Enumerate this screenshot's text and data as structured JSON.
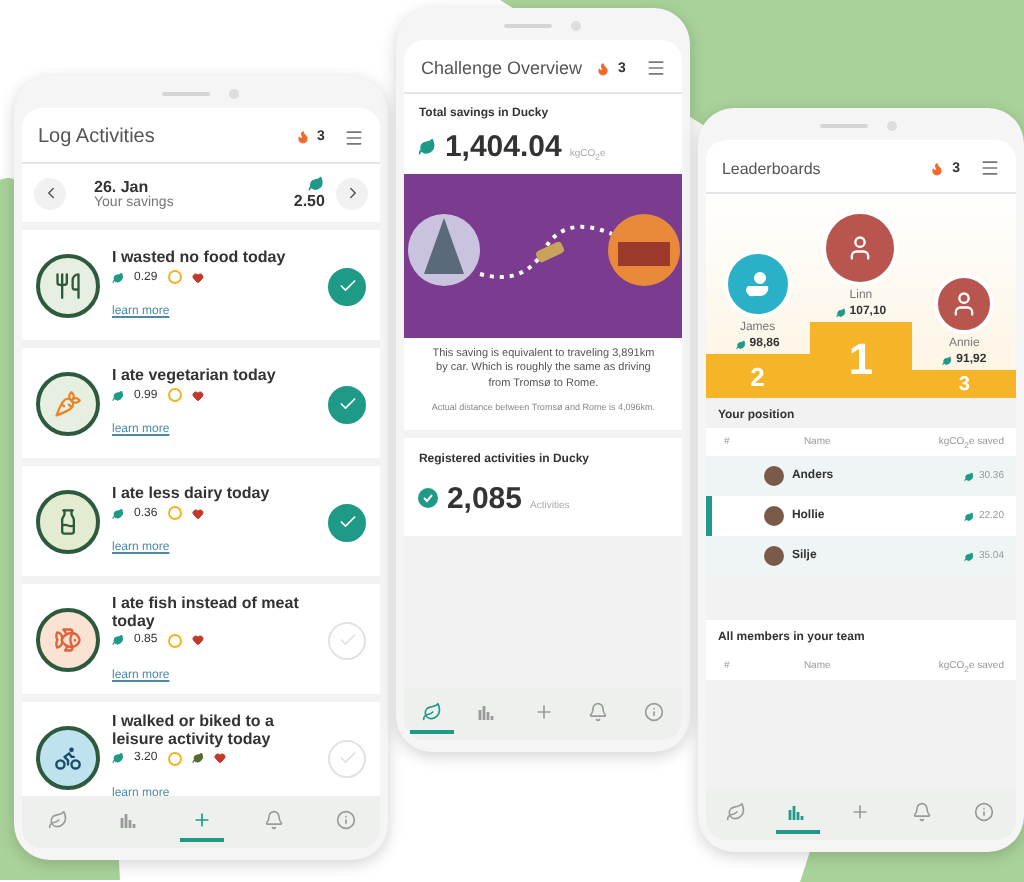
{
  "phones": [
    {
      "kind": "log",
      "title": "Log Activities",
      "streak": "3",
      "date": {
        "day": "26. Jan",
        "caption": "Your savings",
        "amount": "2.50"
      },
      "activities": [
        {
          "title": "I wasted no food today",
          "saving": "0.29",
          "color": "#e6efe0",
          "extra_leaf": false,
          "link": "learn more",
          "checked": true
        },
        {
          "title": "I ate vegetarian today",
          "saving": "0.99",
          "color": "#e6efe0",
          "extra_leaf": false,
          "link": "learn more",
          "checked": true
        },
        {
          "title": "I ate less dairy today",
          "saving": "0.36",
          "color": "#e3ecd0",
          "extra_leaf": false,
          "link": "learn more",
          "checked": true
        },
        {
          "title": "I ate fish instead of meat today",
          "saving": "0.85",
          "color": "#fbe3d3",
          "extra_leaf": false,
          "link": "learn more",
          "checked": false
        },
        {
          "title": "I walked or biked to a leisure activity today",
          "saving": "3.20",
          "color": "#bfe3ee",
          "extra_leaf": true,
          "link": "learn more",
          "checked": false
        }
      ],
      "nav": [
        {
          "kind": "leaf",
          "selected": false
        },
        {
          "kind": "chart",
          "selected": false
        },
        {
          "kind": "add",
          "selected": true
        },
        {
          "kind": "bell",
          "selected": false
        },
        {
          "kind": "info",
          "selected": false
        }
      ]
    },
    {
      "kind": "overview",
      "title": "Challenge Overview",
      "streak": "3",
      "total": {
        "heading": "Total savings in Ducky",
        "value": "1,404.04",
        "unit": "kgCO$_{2}$e"
      },
      "equivalent": "This saving is equivalent to traveling 3,891km by car. Which is roughly the same as driving from Tromsø to Rome.",
      "note": "Actual distance between Tromsø and Rome is 4,096km.",
      "activities": {
        "heading": "Registered activities in Ducky",
        "value": "2,085",
        "unit": "Activities"
      },
      "nav": [
        {
          "kind": "leaf",
          "selected": true
        },
        {
          "kind": "chart",
          "selected": false
        },
        {
          "kind": "add",
          "selected": false
        },
        {
          "kind": "bell",
          "selected": false
        },
        {
          "kind": "info",
          "selected": false
        }
      ]
    },
    {
      "kind": "leaderboard",
      "title": "Leaderboards",
      "streak": "3",
      "podium": [
        {
          "name": "James",
          "score": "98,86",
          "place": "2",
          "kind": "mascot"
        },
        {
          "name": "Linn",
          "score": "107,10",
          "place": "1",
          "kind": "member"
        },
        {
          "name": "Annie",
          "score": "91,92",
          "place": "3",
          "kind": "member"
        }
      ],
      "position": {
        "heading": "Your position",
        "columns": [
          "#",
          "Name",
          "kgCO$_{2}$e saved"
        ],
        "rows": [
          {
            "name": "Anders",
            "value": "30.36",
            "selected": false
          },
          {
            "name": "Hollie",
            "value": "22.20",
            "selected": true
          },
          {
            "name": "Silje",
            "value": "35.04",
            "selected": false
          }
        ]
      },
      "team": {
        "heading": "All members in your team",
        "columns": [
          "#",
          "Name",
          "kgCO$_{2}$e saved"
        ]
      },
      "nav": [
        {
          "kind": "leaf",
          "selected": false
        },
        {
          "kind": "chart",
          "selected": true
        },
        {
          "kind": "add",
          "selected": false
        },
        {
          "kind": "bell",
          "selected": false
        },
        {
          "kind": "info",
          "selected": false
        }
      ]
    }
  ]
}
